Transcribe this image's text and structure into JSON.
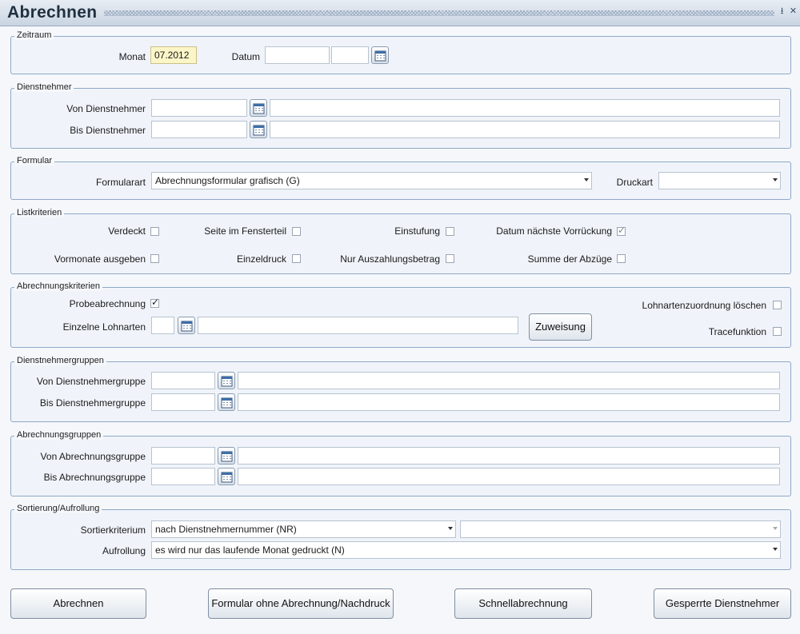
{
  "window": {
    "title": "Abrechnen"
  },
  "zeitraum": {
    "legend": "Zeitraum",
    "monat_label": "Monat",
    "monat_value": "07.2012",
    "datum_label": "Datum",
    "datum_value1": "",
    "datum_value2": ""
  },
  "dienstnehmer": {
    "legend": "Dienstnehmer",
    "von_label": "Von Dienstnehmer",
    "bis_label": "Bis Dienstnehmer"
  },
  "formular": {
    "legend": "Formular",
    "formularart_label": "Formularart",
    "formularart_value": "Abrechnungsformular grafisch (G)",
    "druckart_label": "Druckart",
    "druckart_value": ""
  },
  "listkriterien": {
    "legend": "Listkriterien",
    "verdeckt": "Verdeckt",
    "seite_im_fensterteil": "Seite im Fensterteil",
    "einstufung": "Einstufung",
    "datum_naechste_vorrueckung": "Datum nächste Vorrückung",
    "vormonate_ausgeben": "Vormonate ausgeben",
    "einzeldruck": "Einzeldruck",
    "nur_auszahlungsbetrag": "Nur Auszahlungsbetrag",
    "summe_der_abzuege": "Summe der Abzüge"
  },
  "abrechnungskriterien": {
    "legend": "Abrechnungskriterien",
    "probeabrechnung": "Probeabrechnung",
    "einzelne_lohnarten": "Einzelne Lohnarten",
    "zuweisung_button": "Zuweisung",
    "lohnartenzuordnung_loeschen": "Lohnartenzuordnung löschen",
    "tracefunktion": "Tracefunktion"
  },
  "dienstnehmergruppen": {
    "legend": "Dienstnehmergruppen",
    "von_label": "Von Dienstnehmergruppe",
    "bis_label": "Bis Dienstnehmergruppe"
  },
  "abrechnungsgruppen": {
    "legend": "Abrechnungsgruppen",
    "von_label": "Von Abrechnungsgruppe",
    "bis_label": "Bis Abrechnungsgruppe"
  },
  "sortierung": {
    "legend": "Sortierung/Aufrollung",
    "sortierkriterium_label": "Sortierkriterium",
    "sortierkriterium_value": "nach Dienstnehmernummer (NR)",
    "sortierkriterium2_value": "",
    "aufrollung_label": "Aufrollung",
    "aufrollung_value": "es wird nur das laufende Monat gedruckt (N)"
  },
  "buttons": {
    "abrechnen": "Abrechnen",
    "formular_ohne": "Formular ohne Abrechnung/Nachdruck",
    "schnellabrechnung": "Schnellabrechnung",
    "gesperrte": "Gesperrte Dienstnehmer"
  },
  "checked": {
    "datum_naechste_vorrueckung": true,
    "probeabrechnung": true
  }
}
